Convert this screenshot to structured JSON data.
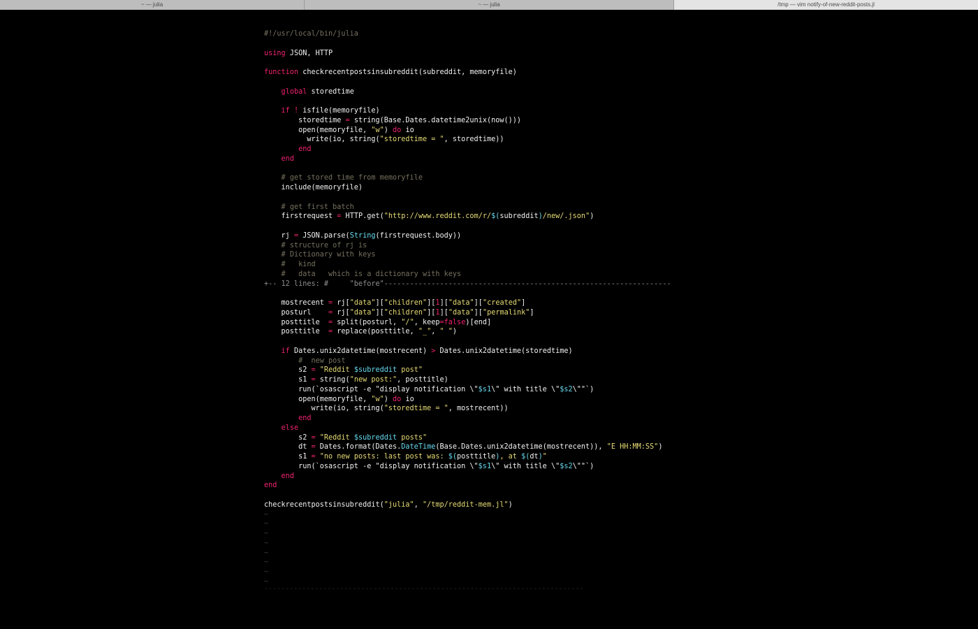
{
  "tabs": [
    {
      "label": "~ — julia"
    },
    {
      "label": "~ — julia"
    },
    {
      "label": "/tmp — vim notify-of-new-reddit-posts.jl"
    }
  ],
  "editor": {
    "code": [
      [
        {
          "t": "#!/usr/local/bin/julia",
          "c": "cm"
        }
      ],
      [],
      [
        {
          "t": "using",
          "c": "kw"
        },
        {
          "t": " JSON, HTTP"
        }
      ],
      [],
      [
        {
          "t": "function",
          "c": "kw"
        },
        {
          "t": " checkrecentpostsinsubreddit(subreddit, memoryfile)"
        }
      ],
      [],
      [
        {
          "t": "    "
        },
        {
          "t": "global",
          "c": "kw"
        },
        {
          "t": " storedtime"
        }
      ],
      [],
      [
        {
          "t": "    "
        },
        {
          "t": "if",
          "c": "kw"
        },
        {
          "t": " "
        },
        {
          "t": "!",
          "c": "op"
        },
        {
          "t": " isfile(memoryfile)"
        }
      ],
      [
        {
          "t": "        storedtime "
        },
        {
          "t": "=",
          "c": "op"
        },
        {
          "t": " string(Base.Dates.datetime2unix(now()))"
        }
      ],
      [
        {
          "t": "        open(memoryfile, "
        },
        {
          "t": "\"w\"",
          "c": "str"
        },
        {
          "t": ") "
        },
        {
          "t": "do",
          "c": "kw"
        },
        {
          "t": " io"
        }
      ],
      [
        {
          "t": "          write(io, string("
        },
        {
          "t": "\"storedtime = \"",
          "c": "str"
        },
        {
          "t": ", storedtime))"
        }
      ],
      [
        {
          "t": "        "
        },
        {
          "t": "end",
          "c": "kw"
        }
      ],
      [
        {
          "t": "    "
        },
        {
          "t": "end",
          "c": "kw"
        }
      ],
      [],
      [
        {
          "t": "    "
        },
        {
          "t": "# get stored time from memoryfile",
          "c": "cm"
        }
      ],
      [
        {
          "t": "    include(memoryfile)"
        }
      ],
      [],
      [
        {
          "t": "    "
        },
        {
          "t": "# get first batch",
          "c": "cm"
        }
      ],
      [
        {
          "t": "    firstrequest "
        },
        {
          "t": "=",
          "c": "op"
        },
        {
          "t": " HTTP.get("
        },
        {
          "t": "\"http://www.reddit.com/r/",
          "c": "str"
        },
        {
          "t": "$(",
          "c": "interp"
        },
        {
          "t": "subreddit"
        },
        {
          "t": ")",
          "c": "interp"
        },
        {
          "t": "/new/.json\"",
          "c": "str"
        },
        {
          "t": ")"
        }
      ],
      [],
      [
        {
          "t": "    rj "
        },
        {
          "t": "=",
          "c": "op"
        },
        {
          "t": " JSON.parse("
        },
        {
          "t": "String",
          "c": "ty"
        },
        {
          "t": "(firstrequest.body))"
        }
      ],
      [
        {
          "t": "    "
        },
        {
          "t": "# structure of rj is",
          "c": "cm"
        }
      ],
      [
        {
          "t": "    "
        },
        {
          "t": "# Dictionary with keys",
          "c": "cm"
        }
      ],
      [
        {
          "t": "    "
        },
        {
          "t": "#   kind",
          "c": "cm"
        }
      ],
      [
        {
          "t": "    "
        },
        {
          "t": "#   data   which is a dictionary with keys",
          "c": "cm"
        }
      ],
      [
        {
          "t": "+-- 12 lines: #     \"before\"-------------------------------------------------------------------",
          "c": "fold"
        }
      ],
      [],
      [
        {
          "t": "    mostrecent "
        },
        {
          "t": "=",
          "c": "op"
        },
        {
          "t": " rj["
        },
        {
          "t": "\"data\"",
          "c": "str"
        },
        {
          "t": "]["
        },
        {
          "t": "\"children\"",
          "c": "str"
        },
        {
          "t": "]["
        },
        {
          "t": "1",
          "c": "kw"
        },
        {
          "t": "]["
        },
        {
          "t": "\"data\"",
          "c": "str"
        },
        {
          "t": "]["
        },
        {
          "t": "\"created\"",
          "c": "str"
        },
        {
          "t": "]"
        }
      ],
      [
        {
          "t": "    posturl    "
        },
        {
          "t": "=",
          "c": "op"
        },
        {
          "t": " rj["
        },
        {
          "t": "\"data\"",
          "c": "str"
        },
        {
          "t": "]["
        },
        {
          "t": "\"children\"",
          "c": "str"
        },
        {
          "t": "]["
        },
        {
          "t": "1",
          "c": "kw"
        },
        {
          "t": "]["
        },
        {
          "t": "\"data\"",
          "c": "str"
        },
        {
          "t": "]["
        },
        {
          "t": "\"permalink\"",
          "c": "str"
        },
        {
          "t": "]"
        }
      ],
      [
        {
          "t": "    posttitle  "
        },
        {
          "t": "=",
          "c": "op"
        },
        {
          "t": " split(posturl, "
        },
        {
          "t": "\"/\"",
          "c": "str"
        },
        {
          "t": ", keep"
        },
        {
          "t": "=",
          "c": "op"
        },
        {
          "t": "false",
          "c": "kw"
        },
        {
          "t": ")[end]"
        }
      ],
      [
        {
          "t": "    posttitle  "
        },
        {
          "t": "=",
          "c": "op"
        },
        {
          "t": " replace(posttitle, "
        },
        {
          "t": "\"_\"",
          "c": "str"
        },
        {
          "t": ", "
        },
        {
          "t": "\" \"",
          "c": "str"
        },
        {
          "t": ")"
        }
      ],
      [],
      [
        {
          "t": "    "
        },
        {
          "t": "if",
          "c": "kw"
        },
        {
          "t": " Dates.unix2datetime(mostrecent) "
        },
        {
          "t": ">",
          "c": "op"
        },
        {
          "t": " Dates.unix2datetime(storedtime)"
        }
      ],
      [
        {
          "t": "        "
        },
        {
          "t": "#  new post",
          "c": "cm"
        }
      ],
      [
        {
          "t": "        s2 "
        },
        {
          "t": "=",
          "c": "op"
        },
        {
          "t": " "
        },
        {
          "t": "\"Reddit ",
          "c": "str"
        },
        {
          "t": "$subreddit",
          "c": "interp"
        },
        {
          "t": " post\"",
          "c": "str"
        }
      ],
      [
        {
          "t": "        s1 "
        },
        {
          "t": "=",
          "c": "op"
        },
        {
          "t": " string("
        },
        {
          "t": "\"new post:\"",
          "c": "str"
        },
        {
          "t": ", posttitle)"
        }
      ],
      [
        {
          "t": "        run(`osascript -e \"display notification \\\""
        },
        {
          "t": "$s1",
          "c": "interp"
        },
        {
          "t": "\\\" with title \\\""
        },
        {
          "t": "$s2",
          "c": "interp"
        },
        {
          "t": "\\\"\"`)"
        }
      ],
      [
        {
          "t": "        open(memoryfile, "
        },
        {
          "t": "\"w\"",
          "c": "str"
        },
        {
          "t": ") "
        },
        {
          "t": "do",
          "c": "kw"
        },
        {
          "t": " io"
        }
      ],
      [
        {
          "t": "           write(io, string("
        },
        {
          "t": "\"storedtime = \"",
          "c": "str"
        },
        {
          "t": ", mostrecent))"
        }
      ],
      [
        {
          "t": "        "
        },
        {
          "t": "end",
          "c": "kw"
        }
      ],
      [
        {
          "t": "    "
        },
        {
          "t": "else",
          "c": "kw"
        }
      ],
      [
        {
          "t": "        s2 "
        },
        {
          "t": "=",
          "c": "op"
        },
        {
          "t": " "
        },
        {
          "t": "\"Reddit ",
          "c": "str"
        },
        {
          "t": "$subreddit",
          "c": "interp"
        },
        {
          "t": " posts\"",
          "c": "str"
        }
      ],
      [
        {
          "t": "        dt "
        },
        {
          "t": "=",
          "c": "op"
        },
        {
          "t": " Dates.format(Dates."
        },
        {
          "t": "DateTime",
          "c": "ty"
        },
        {
          "t": "(Base.Dates.unix2datetime(mostrecent)), "
        },
        {
          "t": "\"E HH:MM:SS\"",
          "c": "str"
        },
        {
          "t": ")"
        }
      ],
      [
        {
          "t": "        s1 "
        },
        {
          "t": "=",
          "c": "op"
        },
        {
          "t": " "
        },
        {
          "t": "\"no new posts: last post was: ",
          "c": "str"
        },
        {
          "t": "$(",
          "c": "interp"
        },
        {
          "t": "posttitle"
        },
        {
          "t": ")",
          "c": "interp"
        },
        {
          "t": ", at ",
          "c": "str"
        },
        {
          "t": "$(",
          "c": "interp"
        },
        {
          "t": "dt"
        },
        {
          "t": ")",
          "c": "interp"
        },
        {
          "t": "\"",
          "c": "str"
        }
      ],
      [
        {
          "t": "        run(`osascript -e \"display notification \\\""
        },
        {
          "t": "$s1",
          "c": "interp"
        },
        {
          "t": "\\\" with title \\\""
        },
        {
          "t": "$s2",
          "c": "interp"
        },
        {
          "t": "\\\"\"`)"
        }
      ],
      [
        {
          "t": "    "
        },
        {
          "t": "end",
          "c": "kw"
        }
      ],
      [
        {
          "t": "end",
          "c": "kw"
        }
      ],
      [],
      [
        {
          "t": "checkrecentpostsinsubreddit("
        },
        {
          "t": "\"julia\"",
          "c": "str"
        },
        {
          "t": ", "
        },
        {
          "t": "\"/tmp/reddit-mem.jl\"",
          "c": "str"
        },
        {
          "t": ")"
        }
      ],
      [
        {
          "t": "~",
          "c": "tilde"
        }
      ],
      [
        {
          "t": "~",
          "c": "tilde"
        }
      ],
      [
        {
          "t": "~",
          "c": "tilde"
        }
      ],
      [
        {
          "t": "~",
          "c": "tilde"
        }
      ],
      [
        {
          "t": "~",
          "c": "tilde"
        }
      ],
      [
        {
          "t": "~",
          "c": "tilde"
        }
      ],
      [
        {
          "t": "~",
          "c": "tilde"
        }
      ],
      [
        {
          "t": "~",
          "c": "tilde"
        }
      ]
    ]
  },
  "statusline": {
    "text": "----------------------------------------------------------------------------"
  }
}
